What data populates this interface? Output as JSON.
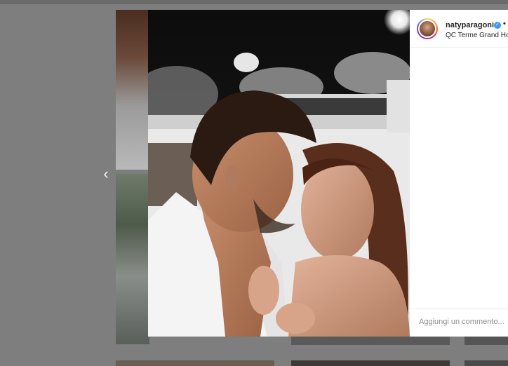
{
  "post": {
    "username": "natyparagoni",
    "verified_icon": "verified-badge-icon",
    "separator": "•",
    "location": "QC Terme Grand Hotel",
    "comment_placeholder": "Aggiungi un commento..."
  },
  "navigation": {
    "prev_icon": "chevron-left-icon",
    "prev_glyph": "‹"
  },
  "colors": {
    "accent": "#3897f0",
    "text": "#262626",
    "muted": "#8e8e8e"
  }
}
